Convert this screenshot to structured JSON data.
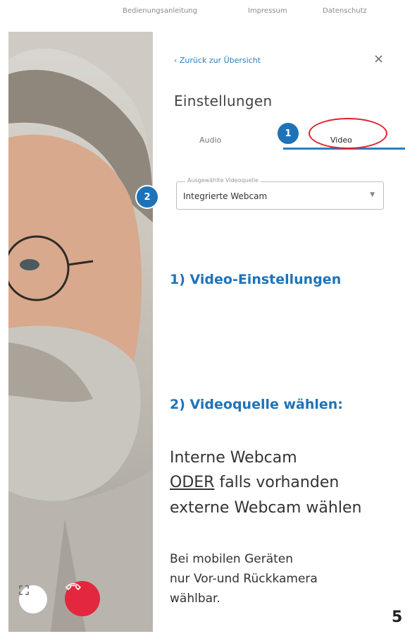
{
  "topnav": {
    "link1": "Bedienungsanleitung",
    "link2": "Impressum",
    "link3": "Datenschutz"
  },
  "panel": {
    "back_label": "‹ Zurück zur Übersicht",
    "close_icon": "close-icon",
    "title": "Einstellungen",
    "tabs": [
      {
        "label": "Audio",
        "active": false
      },
      {
        "label": "Video",
        "active": true
      }
    ],
    "select": {
      "legend": "Ausgewählte Videoquelle",
      "value": "Integrierte Webcam"
    }
  },
  "badges": [
    "1",
    "2"
  ],
  "instructions": {
    "heading1": "1) Video-Einstellungen",
    "heading2": "2) Videoquelle wählen:",
    "line1": "Interne Webcam",
    "line2_underlined": "ODER",
    "line2_rest": " falls vorhanden",
    "line3": "externe Webcam wählen",
    "small1": "Bei mobilen Geräten",
    "small2": "nur Vor-und Rückkamera",
    "small3": "wählbar."
  },
  "page_number": "5",
  "colors": {
    "accent": "#1e73b8",
    "link": "#2b7fc2",
    "highlight": "#e0202a",
    "hangup": "#e3273f"
  },
  "controls": {
    "fullscreen_icon": "fullscreen-icon",
    "hangup_icon": "phone-hangup-icon"
  }
}
